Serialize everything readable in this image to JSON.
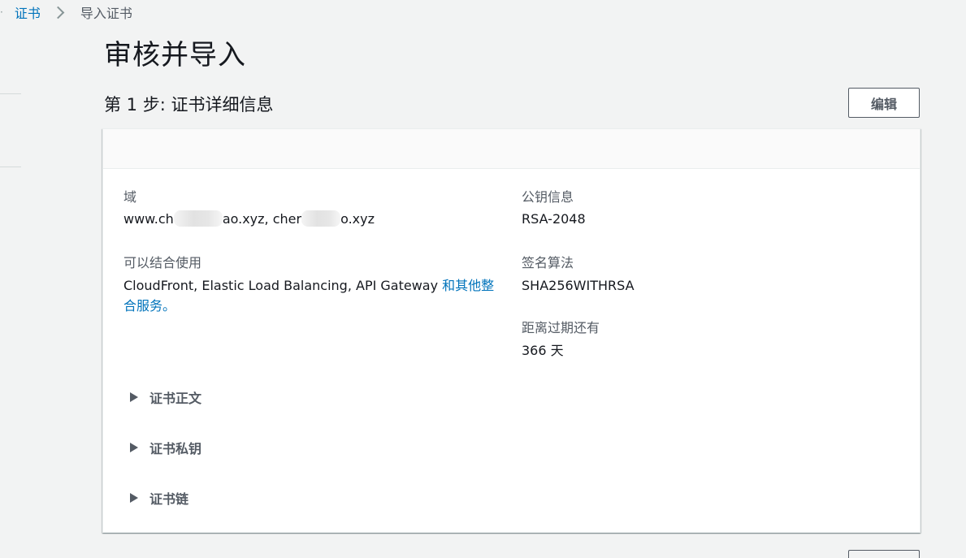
{
  "breadcrumb": {
    "items": [
      {
        "label": "证书"
      },
      {
        "label": "导入证书"
      }
    ]
  },
  "page": {
    "title": "审核并导入"
  },
  "step": {
    "title": "第 1 步: 证书详细信息",
    "edit_label": "编辑"
  },
  "details": {
    "domain": {
      "label": "域",
      "value_part1": "www.ch",
      "value_part2": "ao.xyz, cher",
      "value_part3": "o.xyz"
    },
    "usage": {
      "label": "可以结合使用",
      "value": "CloudFront, Elastic Load Balancing, API Gateway ",
      "link_text": "和其他整合服务。"
    },
    "public_key": {
      "label": "公钥信息",
      "value": "RSA-2048"
    },
    "signature": {
      "label": "签名算法",
      "value": "SHA256WITHRSA"
    },
    "expiry": {
      "label": "距离过期还有",
      "value": "366 天"
    }
  },
  "expanders": [
    {
      "label": "证书正文"
    },
    {
      "label": "证书私钥"
    },
    {
      "label": "证书链"
    }
  ],
  "colors": {
    "link": "#0073bb",
    "page_bg": "#f2f3f3",
    "text": "#16191f",
    "muted": "#545b64"
  },
  "icons": {
    "breadcrumb_separator": "chevron-right-icon",
    "expander": "caret-right-icon"
  }
}
